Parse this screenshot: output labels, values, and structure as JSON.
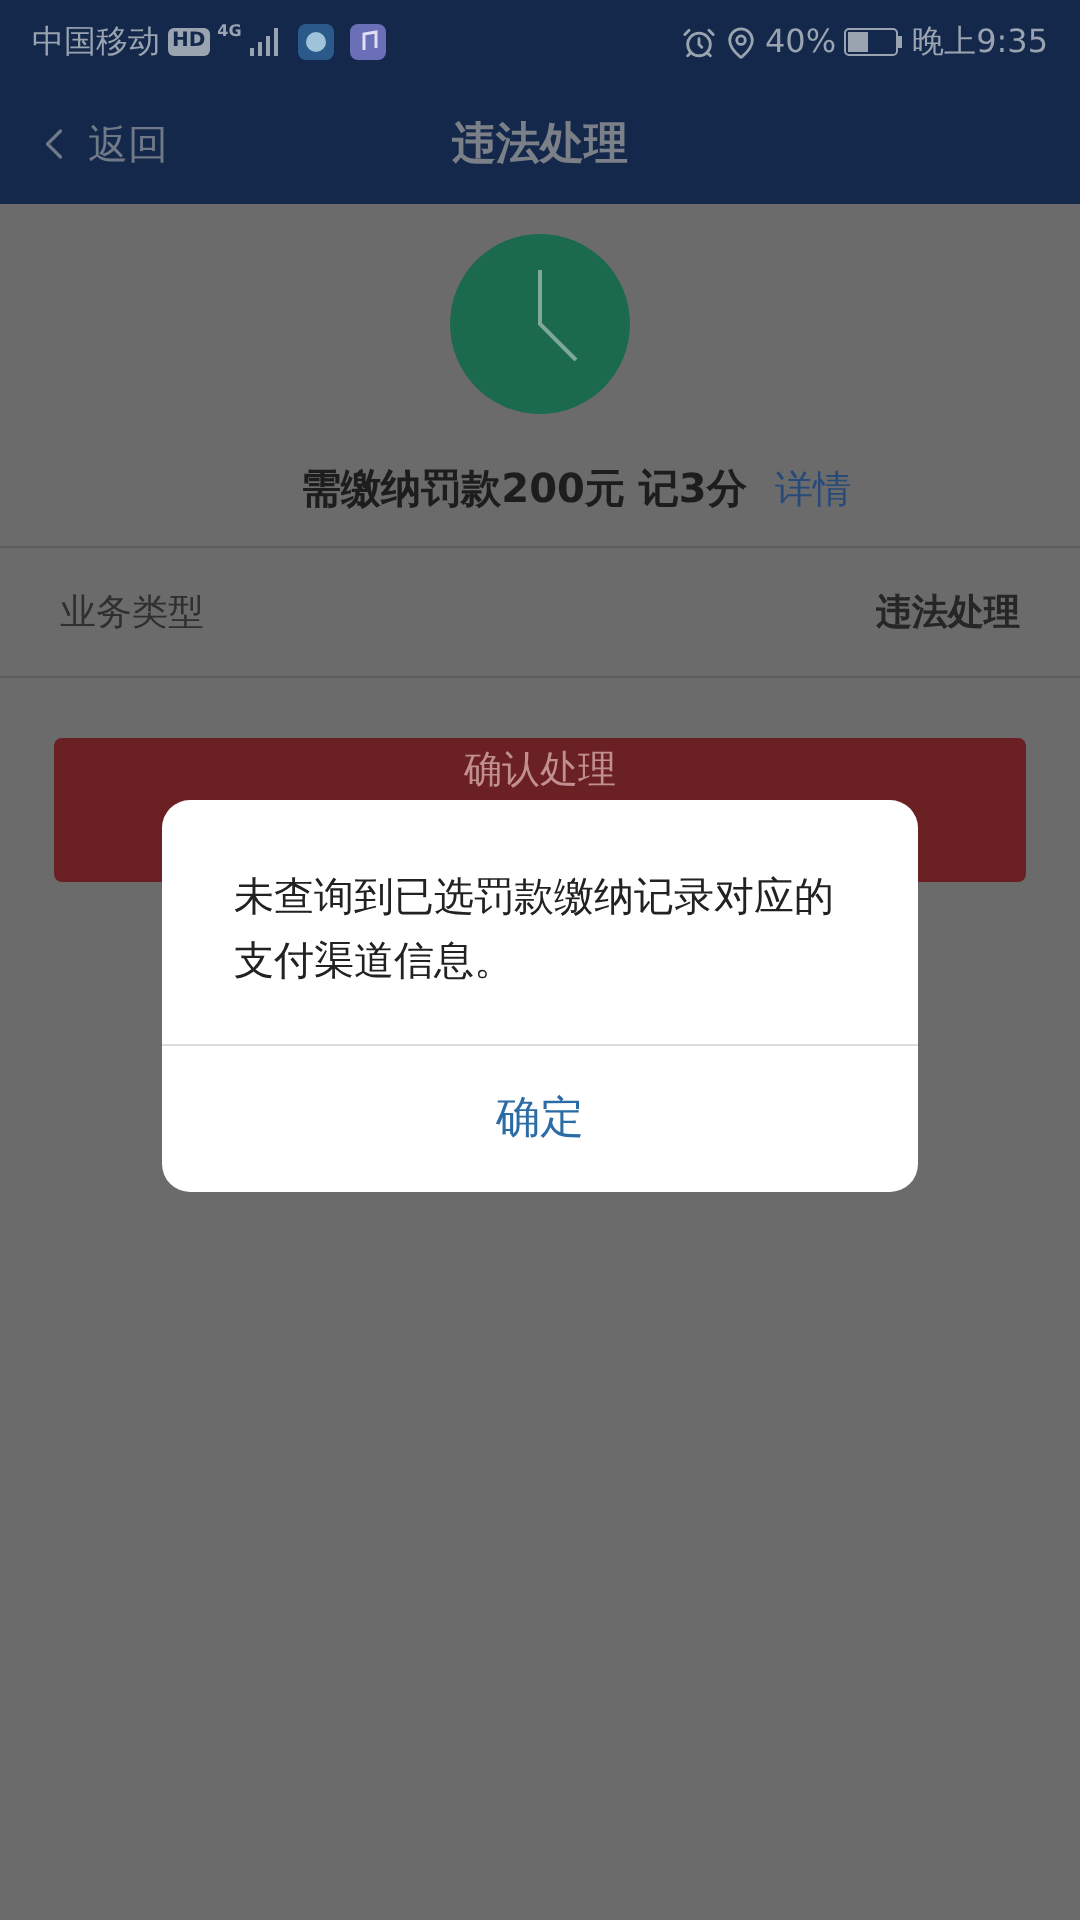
{
  "status_bar": {
    "carrier": "中国移动",
    "hd": "HD",
    "network": "4G",
    "battery": "40%",
    "time": "晚上9:35"
  },
  "nav": {
    "back": "返回",
    "title": "违法处理"
  },
  "summary": {
    "text": "需缴纳罚款200元 记3分",
    "link": "详情"
  },
  "rows": [
    {
      "label": "业务类型",
      "value": "违法处理"
    }
  ],
  "primary_button": "确认处理",
  "dialog": {
    "message": "未查询到已选罚款缴纳记录对应的支付渠道信息。",
    "button": "确定"
  }
}
